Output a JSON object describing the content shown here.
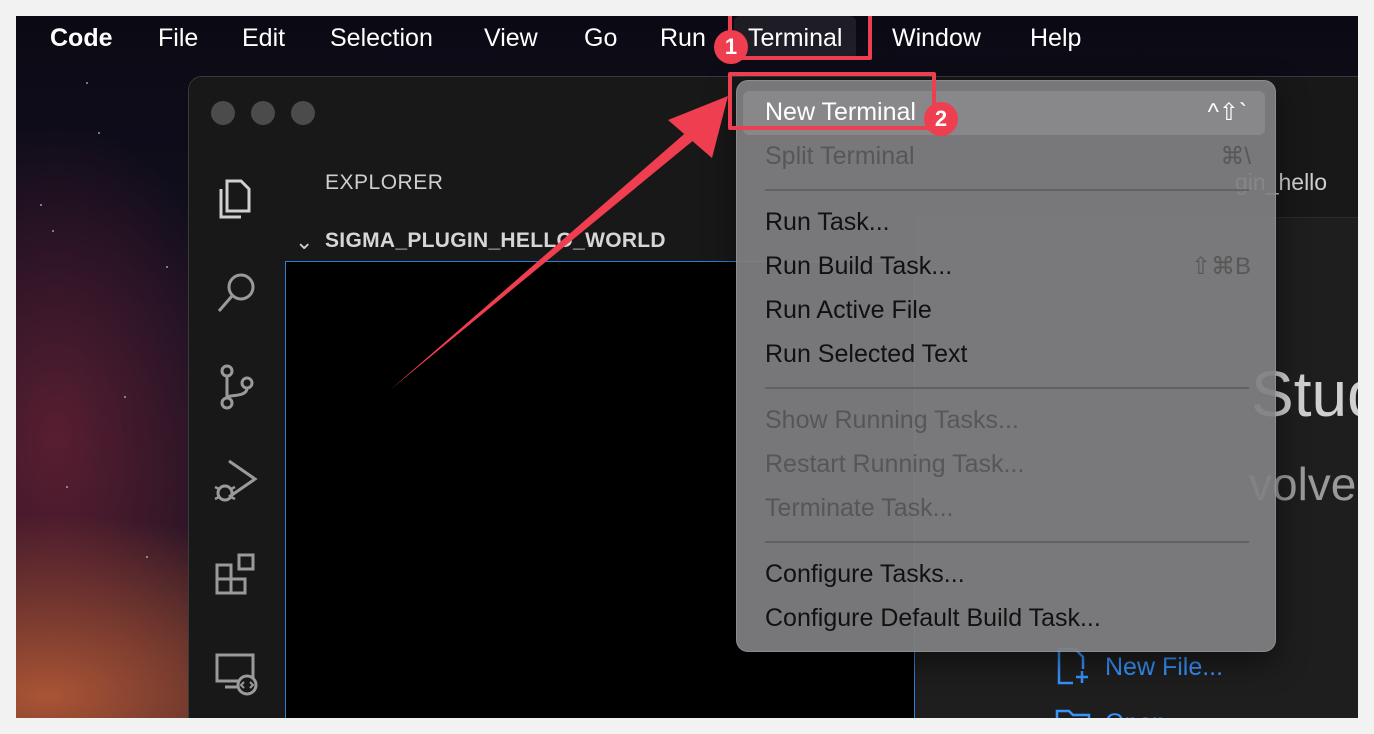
{
  "menubar": {
    "items": [
      "Code",
      "File",
      "Edit",
      "Selection",
      "View",
      "Go",
      "Run",
      "Terminal",
      "Window",
      "Help"
    ]
  },
  "explorer": {
    "title": "EXPLORER",
    "folder_name": "SIGMA_PLUGIN_HELLO_WORLD"
  },
  "editor": {
    "tab_partial": "gin_hello",
    "welcome_title_partial": "Stud",
    "welcome_subtitle_partial": "volve",
    "start_links": [
      "New File...",
      "Open"
    ]
  },
  "terminal_menu": {
    "items": [
      {
        "label": "New Terminal",
        "shortcut": "^⇧`"
      },
      {
        "label": "Split Terminal",
        "shortcut": "⌘\\"
      },
      {
        "label": "Run Task..."
      },
      {
        "label": "Run Build Task...",
        "shortcut": "⇧⌘B"
      },
      {
        "label": "Run Active File"
      },
      {
        "label": "Run Selected Text"
      },
      {
        "label": "Show Running Tasks..."
      },
      {
        "label": "Restart Running Task..."
      },
      {
        "label": "Terminate Task..."
      },
      {
        "label": "Configure Tasks..."
      },
      {
        "label": "Configure Default Build Task..."
      }
    ]
  },
  "annotations": {
    "badges": [
      "1",
      "2"
    ],
    "color": "#ef3e4f"
  },
  "colors": {
    "link": "#3794ff",
    "focus_border": "#2f7fd6"
  }
}
